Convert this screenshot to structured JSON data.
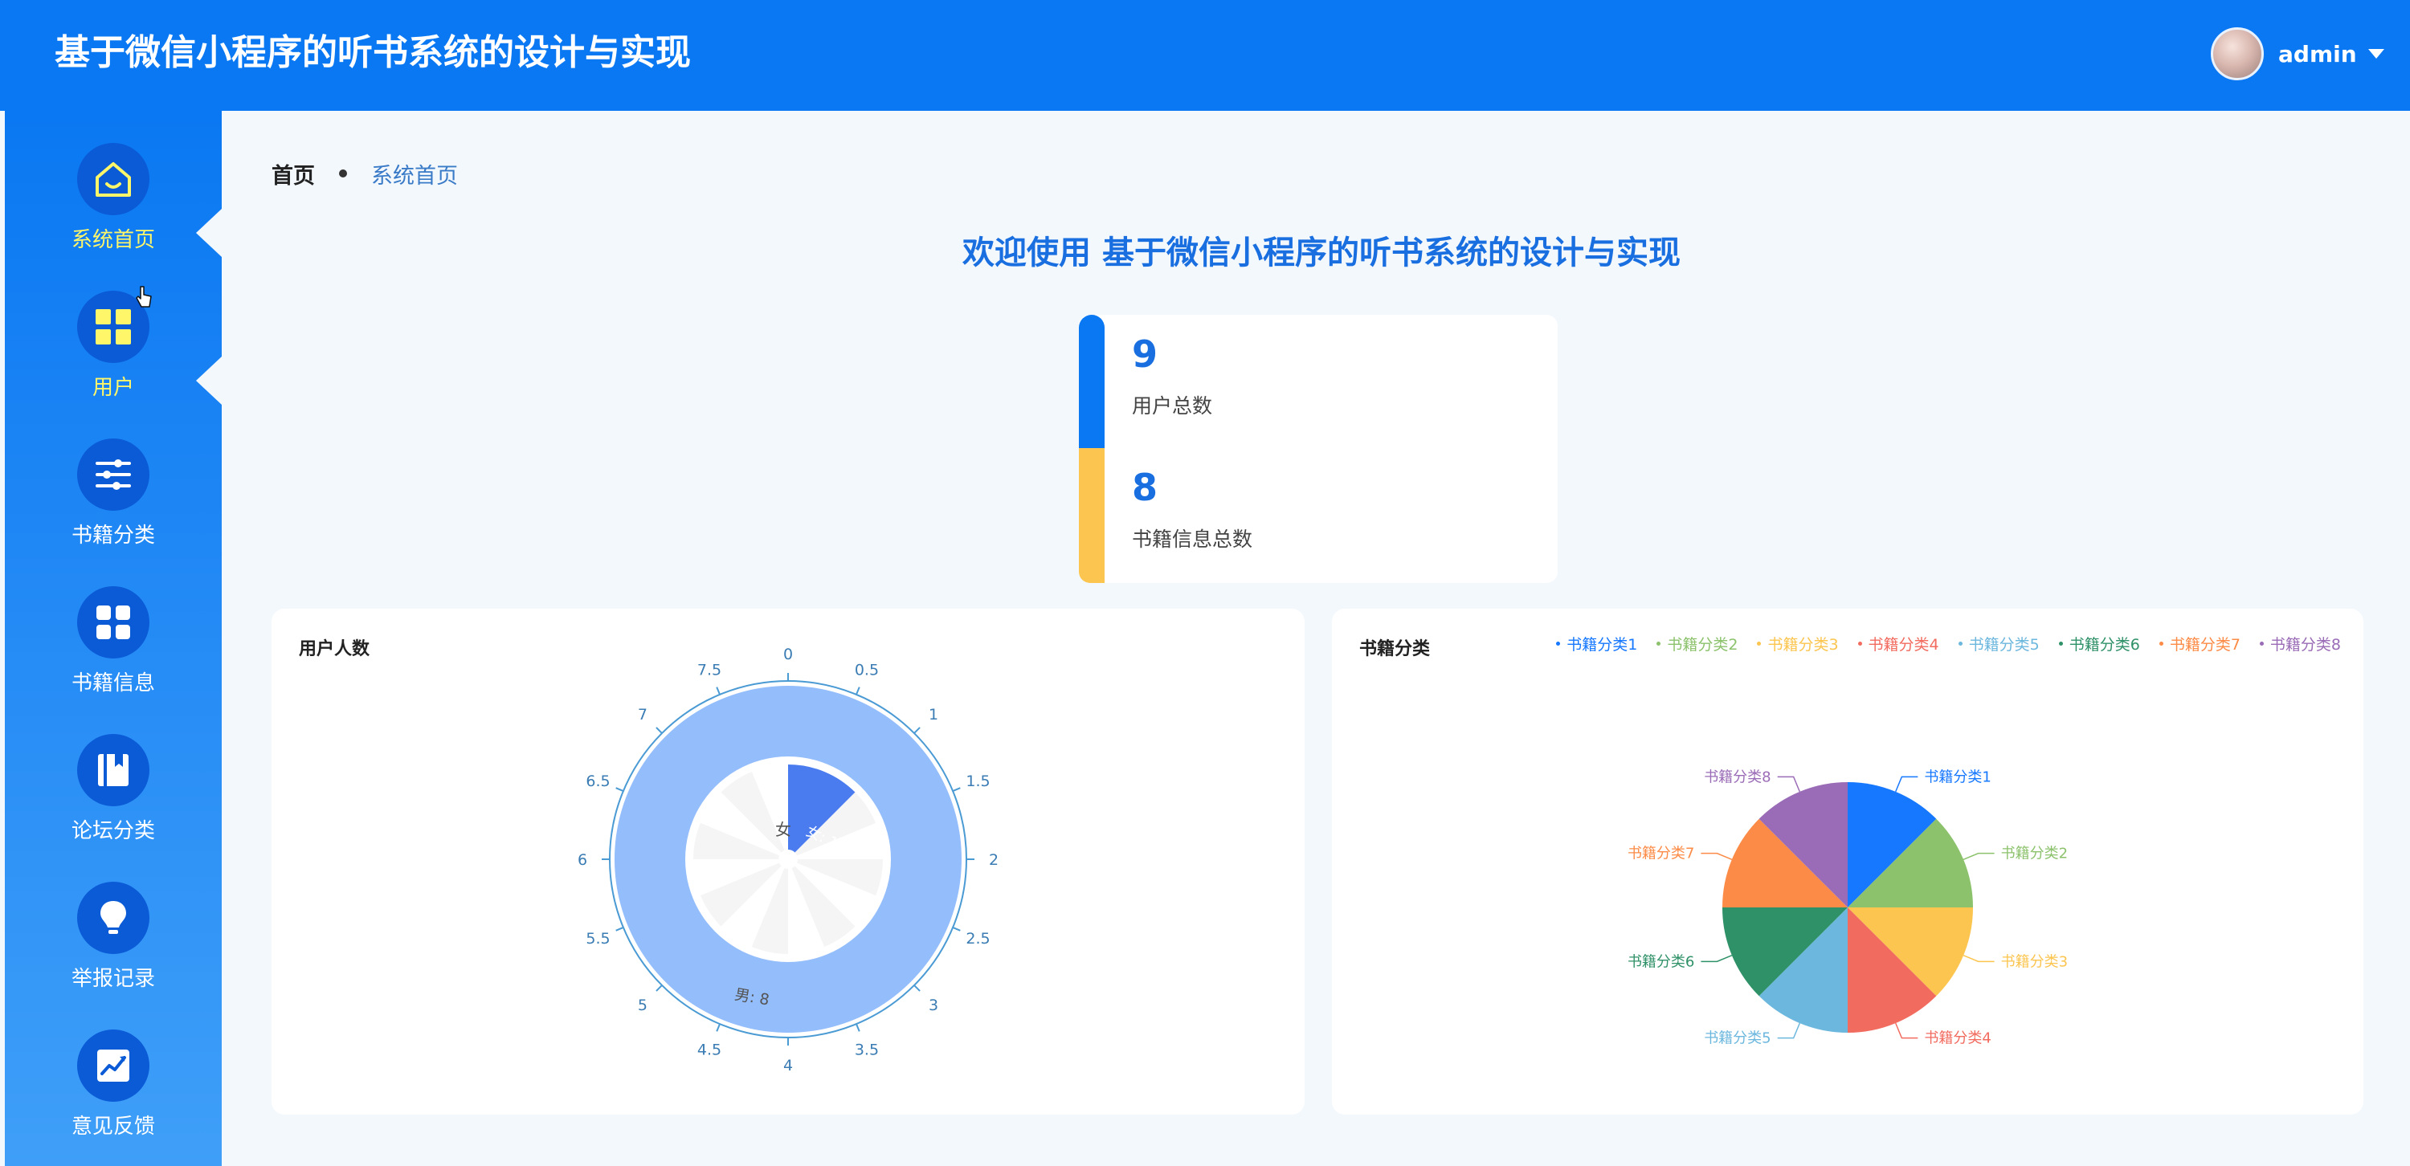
{
  "app": {
    "title": "基于微信小程序的听书系统的设计与实现"
  },
  "user": {
    "name": "admin"
  },
  "sidebar": {
    "items": [
      {
        "label": "系统首页",
        "icon": "home-icon"
      },
      {
        "label": "用户",
        "icon": "grid-icon"
      },
      {
        "label": "书籍分类",
        "icon": "sliders-icon"
      },
      {
        "label": "书籍信息",
        "icon": "apps-icon"
      },
      {
        "label": "论坛分类",
        "icon": "book-icon"
      },
      {
        "label": "举报记录",
        "icon": "lightbulb-icon"
      },
      {
        "label": "意见反馈",
        "icon": "trend-chart-icon"
      }
    ]
  },
  "breadcrumb": {
    "home": "首页",
    "current": "系统首页"
  },
  "welcome": "欢迎使用 基于微信小程序的听书系统的设计与实现",
  "stats": [
    {
      "value": "9",
      "label": "用户总数"
    },
    {
      "value": "8",
      "label": "书籍信息总数"
    }
  ],
  "colors": {
    "primary": "#0a78f2",
    "accent_yellow": "#fbc54f",
    "active_text": "#fff66a"
  },
  "chart_data": [
    {
      "type": "polar-bar",
      "title": "用户人数",
      "angle_axis": {
        "min": 0,
        "max": 8,
        "ticks": [
          "0",
          "0.5",
          "1",
          "1.5",
          "2",
          "2.5",
          "3",
          "3.5",
          "4",
          "4.5",
          "5",
          "5.5",
          "6",
          "6.5",
          "7",
          "7.5"
        ]
      },
      "radius_categories": [
        "女",
        "男"
      ],
      "values": [
        1,
        8
      ],
      "data_labels": [
        "女: 1",
        "男: 8"
      ]
    },
    {
      "type": "pie",
      "title": "书籍分类",
      "categories": [
        "书籍分类1",
        "书籍分类2",
        "书籍分类3",
        "书籍分类4",
        "书籍分类5",
        "书籍分类6",
        "书籍分类7",
        "书籍分类8"
      ],
      "values": [
        1,
        1,
        1,
        1,
        1,
        1,
        1,
        1
      ],
      "colors": [
        "#1677ff",
        "#8cc26c",
        "#fbc54f",
        "#f26b5f",
        "#6cb7de",
        "#2f9168",
        "#fb8b46",
        "#9a6bb6"
      ],
      "legend": "top-right"
    }
  ]
}
